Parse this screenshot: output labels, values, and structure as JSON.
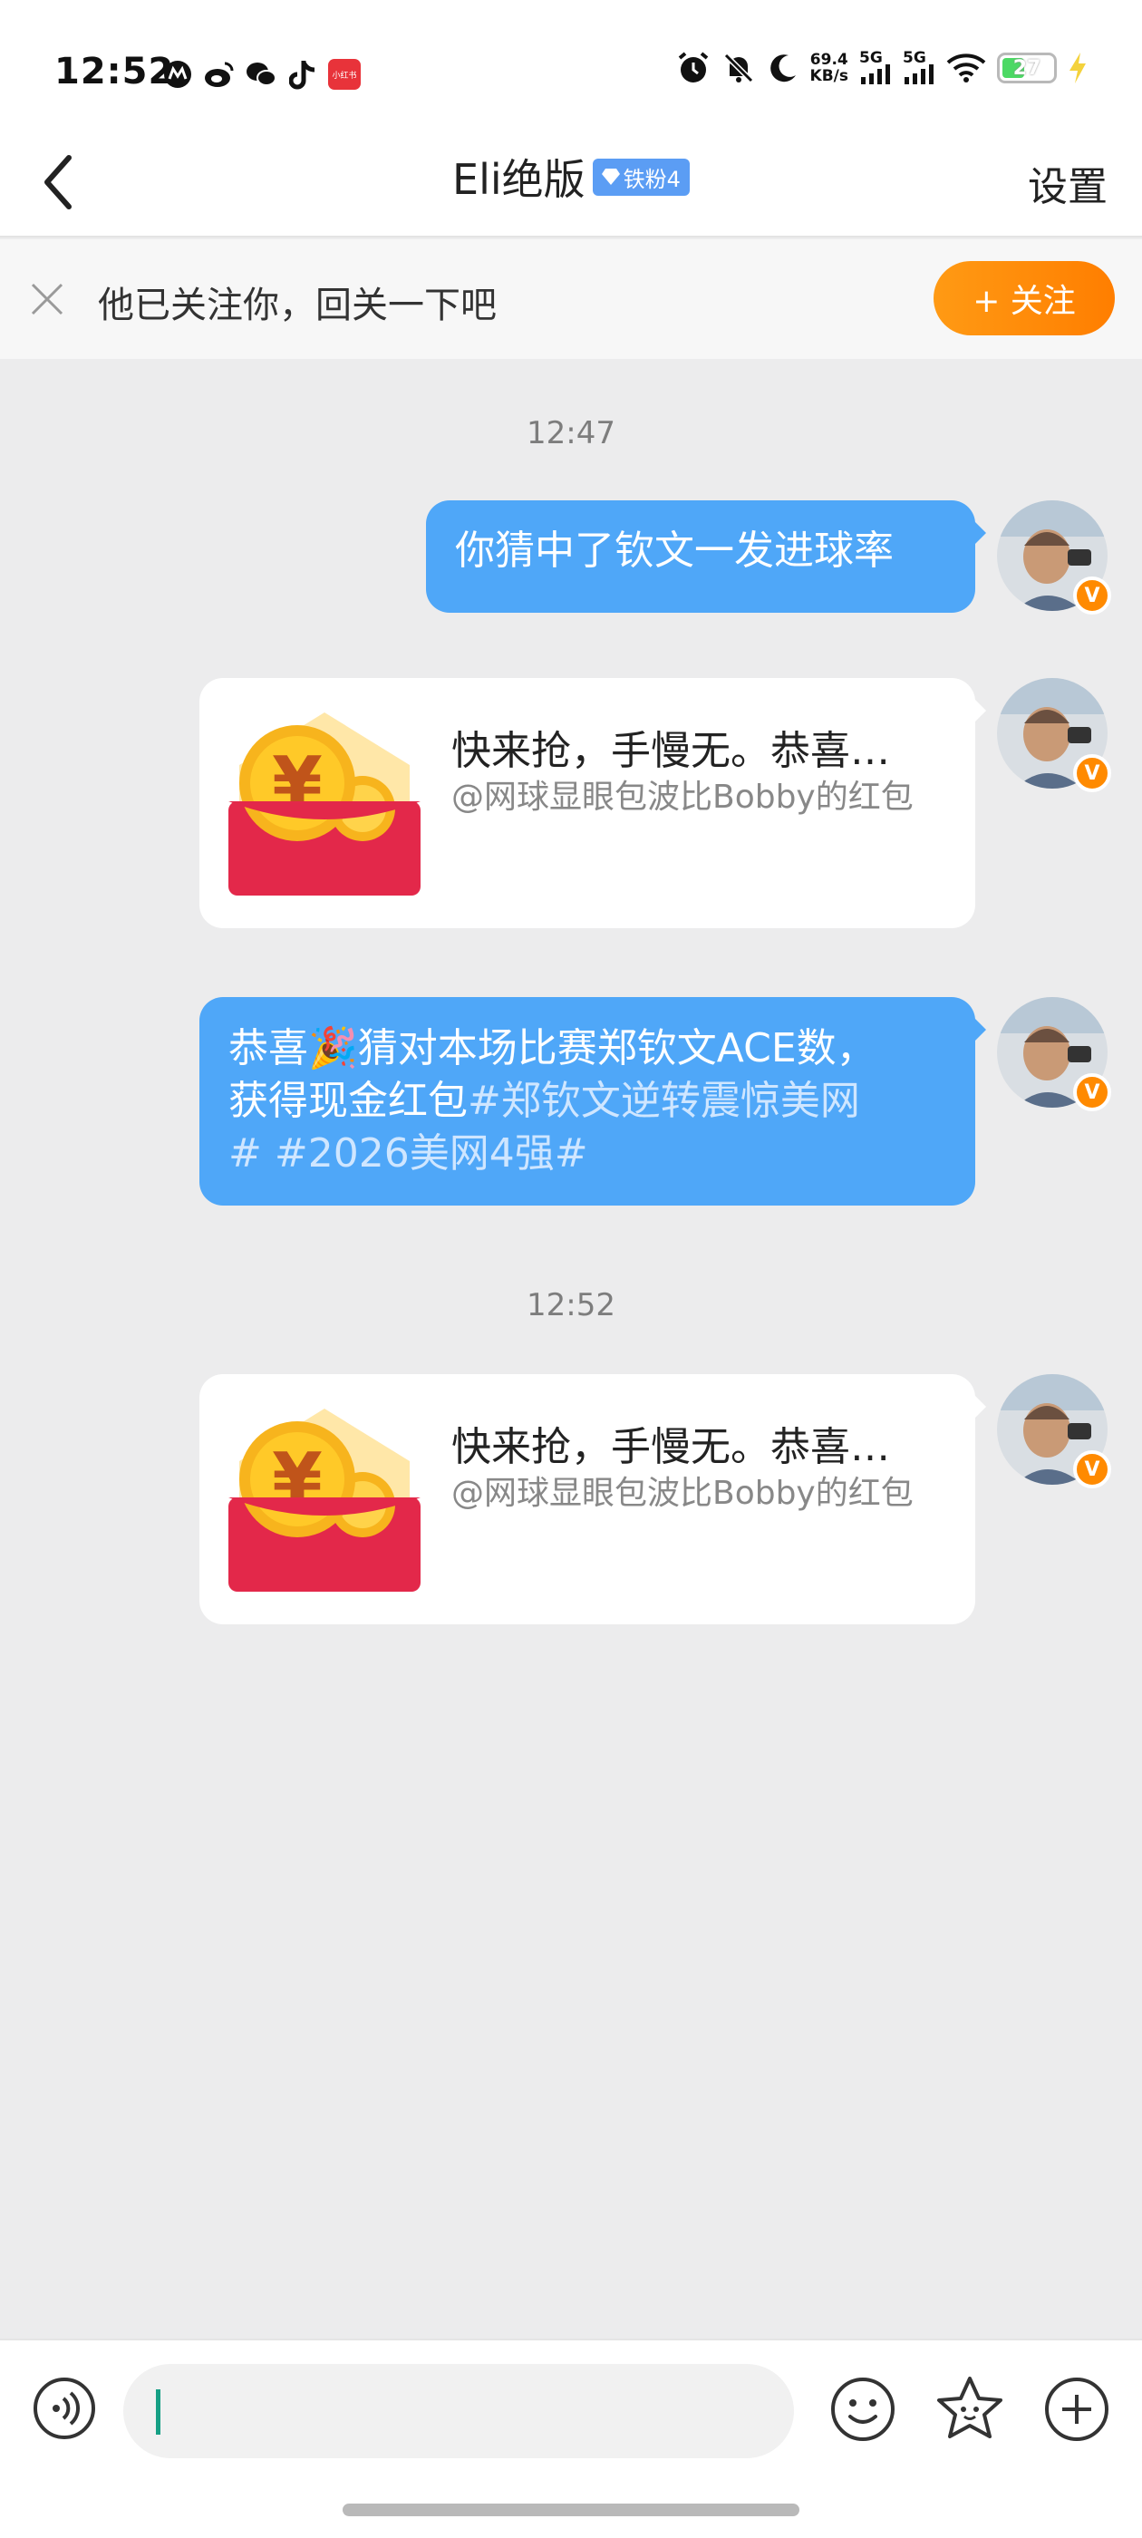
{
  "status_bar": {
    "time": "12:52",
    "net_speed_value": "69.4",
    "net_speed_unit": "KB/s",
    "signal1": "5G",
    "signal2": "5G",
    "battery": "27",
    "app_icon_redbook": "小红书",
    "icons": [
      "mtr-icon",
      "weibo-icon",
      "wechat-icon",
      "tiktok-icon",
      "xiaohongshu-icon",
      "alarm-icon",
      "mute-icon",
      "moon-icon",
      "wifi-icon",
      "charging-icon"
    ]
  },
  "header": {
    "back_icon": "chevron-left-icon",
    "title": "Eli绝版",
    "badge": "铁粉4",
    "settings": "设置"
  },
  "follow_banner": {
    "text": "他已关注你，回关一下吧",
    "button": "+ 关注"
  },
  "messages": {
    "time1": "12:47",
    "m1_text": "你猜中了钦文一发进球率",
    "m2_title": "快来抢，手慢无。恭喜…",
    "m2_sub": "@网球显眼包波比Bobby的红包",
    "m3_line1": "恭喜🎉猜对本场比赛郑钦文ACE数，",
    "m3_line2_plain": "获得现金红包",
    "m3_line2_tag": "#郑钦文逆转震惊美网",
    "m3_line3": "# #2026美网4强#",
    "time2": "12:52",
    "m4_title": "快来抢，手慢无。恭喜…",
    "m4_sub": "@网球显眼包波比Bobby的红包",
    "verified_mark": "V"
  },
  "input_bar": {
    "placeholder": "",
    "icons": [
      "voice-icon",
      "emoji-icon",
      "sticker-icon",
      "plus-icon"
    ]
  },
  "colors": {
    "bubble_blue": "#4fa7f8",
    "follow_orange": "#ff8a00",
    "background": "#ececed"
  }
}
